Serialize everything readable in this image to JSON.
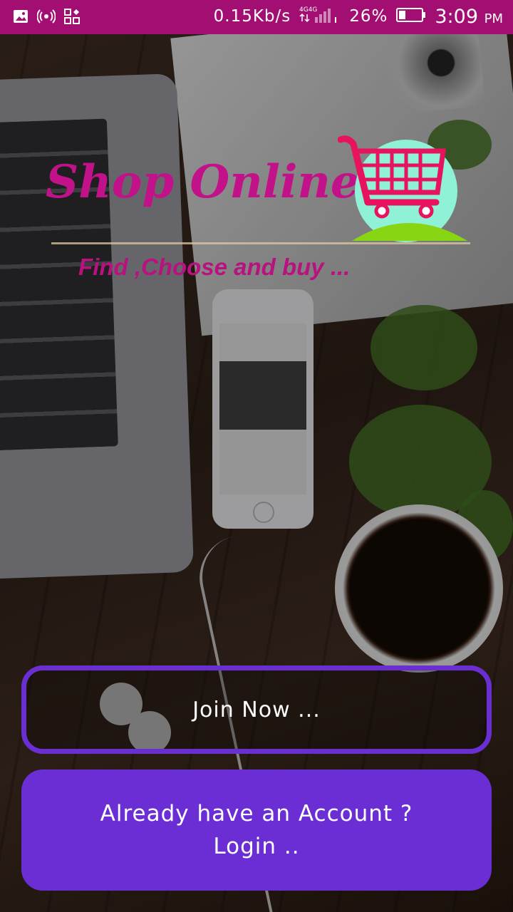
{
  "status_bar": {
    "net_speed": "0.15Kb/s",
    "network": "4G 4G",
    "battery_percent": "26%",
    "time": "3:09",
    "ampm": "PM",
    "icons": [
      "image-icon",
      "hotspot-icon",
      "qr-icon",
      "signal-icon",
      "battery-icon"
    ],
    "background": "#a30e73"
  },
  "logo": {
    "title": "Shop Online",
    "tagline": "Find ,Choose and buy ...",
    "icon": "shopping-cart-icon",
    "title_color": "#c2128a",
    "cart_color": "#e8135f",
    "circle_color": "#8ff1d6",
    "smile_color": "#88d613"
  },
  "buttons": {
    "join_label": "Join Now ...",
    "login_line1": "Already have an Account ?",
    "login_line2": "Login ..",
    "accent": "#6a2ed4"
  }
}
